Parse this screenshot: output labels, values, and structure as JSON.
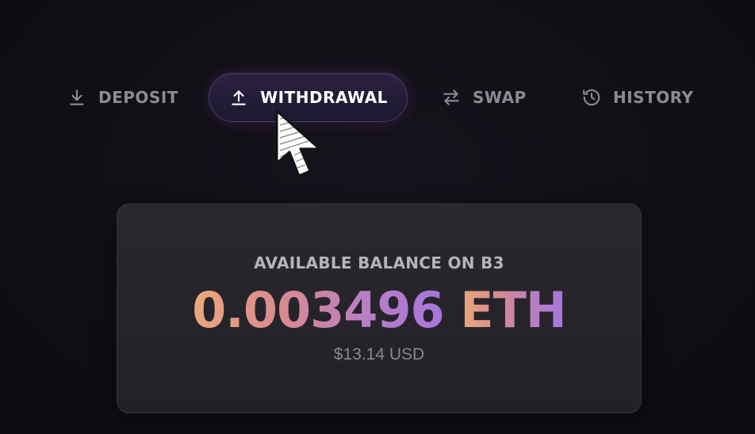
{
  "tabs": {
    "deposit": {
      "label": "DEPOSIT",
      "icon": "download-icon"
    },
    "withdrawal": {
      "label": "WITHDRAWAL",
      "icon": "upload-icon",
      "active": true
    },
    "swap": {
      "label": "SWAP",
      "icon": "swap-arrows-icon"
    },
    "history": {
      "label": "HISTORY",
      "icon": "history-clock-icon"
    }
  },
  "balance": {
    "label": "AVAILABLE BALANCE ON B3",
    "amount": "0.003496",
    "currency": "ETH",
    "fiat": "$13.14 USD"
  },
  "colors": {
    "background": "#110e15",
    "active_tab_border": "#4a3c6a",
    "gradient_start": "#e9a97a",
    "gradient_end": "#a675dc"
  }
}
